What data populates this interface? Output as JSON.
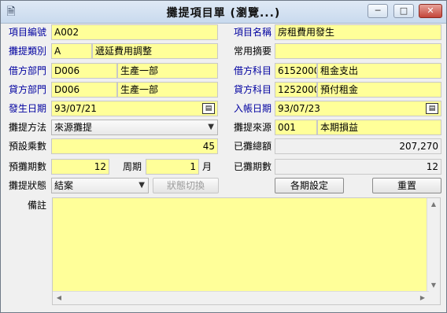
{
  "window": {
    "title": "攤提項目單 (瀏覽...)",
    "min": "─",
    "max": "□",
    "close": "✕"
  },
  "left": {
    "item_code": {
      "label": "項目編號",
      "value": "A002"
    },
    "category": {
      "label": "攤提類別",
      "code": "A",
      "name": "遞延費用調整"
    },
    "debit_dept": {
      "label": "借方部門",
      "code": "D006",
      "name": "生產一部"
    },
    "credit_dept": {
      "label": "貸方部門",
      "code": "D006",
      "name": "生產一部"
    },
    "occur_date": {
      "label": "發生日期",
      "value": "93/07/21"
    },
    "method": {
      "label": "攤提方法",
      "value": "來源攤提"
    },
    "multiplier": {
      "label": "預設乘數",
      "value": "45"
    },
    "periods": {
      "label": "預攤期數",
      "value": "12",
      "cycle_label": "周期",
      "cycle_value": "1",
      "unit": "月"
    },
    "status": {
      "label": "攤提狀態",
      "value": "結案",
      "switch_button": "狀態切換"
    }
  },
  "right": {
    "item_name": {
      "label": "項目名稱",
      "value": "房租費用發生"
    },
    "summary": {
      "label": "常用摘要",
      "value": ""
    },
    "debit_account": {
      "label": "借方科目",
      "code": "6152000",
      "name": "租金支出"
    },
    "credit_account": {
      "label": "貸方科目",
      "code": "1252000",
      "name": "預付租金"
    },
    "entry_date": {
      "label": "入帳日期",
      "value": "93/07/23"
    },
    "source": {
      "label": "攤提來源",
      "code": "001",
      "name": "本期損益"
    },
    "total": {
      "label": "已攤總額",
      "value": "207,270"
    },
    "periods_done": {
      "label": "已攤期數",
      "value": "12"
    },
    "period_settings_button": "各期設定",
    "reset_button": "重置"
  },
  "memo": {
    "label": "備註",
    "value": ""
  }
}
